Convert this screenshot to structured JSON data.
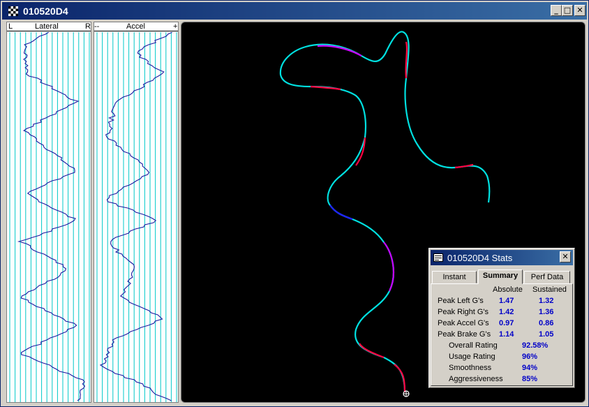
{
  "window": {
    "title": "010520D4",
    "minimize": "_",
    "maximize": "□",
    "close": "✕"
  },
  "lateral_strip": {
    "left": "L",
    "title": "Lateral",
    "right": "R"
  },
  "accel_strip": {
    "left": "--",
    "title": "Accel",
    "right": "+"
  },
  "stats": {
    "title": "010520D4 Stats",
    "close": "✕",
    "tabs": [
      "Instant",
      "Summary",
      "Perf Data"
    ],
    "active_tab": "Summary",
    "col_absolute": "Absolute",
    "col_sustained": "Sustained",
    "peaks": [
      {
        "label": "Peak Left G's",
        "absolute": "1.47",
        "sustained": "1.32"
      },
      {
        "label": "Peak Right G's",
        "absolute": "1.42",
        "sustained": "1.36"
      },
      {
        "label": "Peak Accel G's",
        "absolute": "0.97",
        "sustained": "0.86"
      },
      {
        "label": "Peak Brake G's",
        "absolute": "1.14",
        "sustained": "1.05"
      }
    ],
    "ratings": [
      {
        "label": "Overall Rating",
        "value": "92.58%"
      },
      {
        "label": "Usage Rating",
        "value": "96%"
      },
      {
        "label": "Smoothness",
        "value": "94%"
      },
      {
        "label": "Aggressiveness",
        "value": "85%"
      }
    ]
  },
  "colors": {
    "grid": "#00c8c8",
    "trace": "#1a1aa0",
    "track": "#00e0e0",
    "hot": "#ff0040",
    "warm": "#c800ff",
    "mid": "#2020ff"
  }
}
